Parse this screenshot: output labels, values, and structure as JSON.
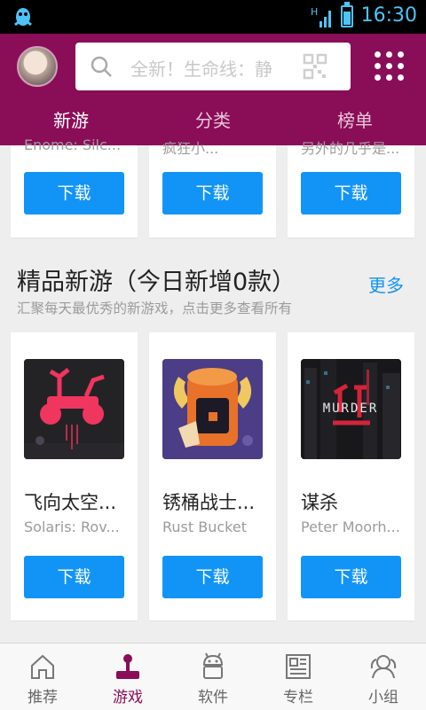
{
  "status_bar": {
    "time": "16:30",
    "network": "H"
  },
  "header": {
    "search_placeholder": "全新！生命线：静",
    "tabs": [
      {
        "label": "新游",
        "active": true
      },
      {
        "label": "分类",
        "active": false
      },
      {
        "label": "榜单",
        "active": false
      }
    ]
  },
  "top_row": [
    {
      "peek": "Enome: Silc...",
      "download": "下载"
    },
    {
      "peek": "疯狂小...",
      "download": "下载"
    },
    {
      "peek": "另外的几乎是...",
      "download": "下载"
    }
  ],
  "section": {
    "title": "精品新游（今日新增0款）",
    "more": "更多",
    "subtitle": "汇聚每天最优秀的新游戏，点击更多查看所有"
  },
  "games": [
    {
      "name": "飞向太空...",
      "developer": "Solaris: Rov...",
      "download": "下载",
      "icon": "rover-icon"
    },
    {
      "name": "锈桶战士...",
      "developer": "Rust Bucket",
      "download": "下载",
      "icon": "helmet-knight-icon"
    },
    {
      "name": "谋杀",
      "developer": "Peter Moorh...",
      "download": "下载",
      "icon": "murder-city-icon",
      "icon_text": "MURDER"
    }
  ],
  "bottom_nav": [
    {
      "label": "推荐",
      "icon": "home-icon",
      "active": false
    },
    {
      "label": "游戏",
      "icon": "joystick-icon",
      "active": true
    },
    {
      "label": "软件",
      "icon": "android-icon",
      "active": false
    },
    {
      "label": "专栏",
      "icon": "newspaper-icon",
      "active": false
    },
    {
      "label": "小组",
      "icon": "group-icon",
      "active": false
    }
  ],
  "colors": {
    "brand": "#8a0d58",
    "button": "#1294f6",
    "background": "#eeeeee"
  }
}
